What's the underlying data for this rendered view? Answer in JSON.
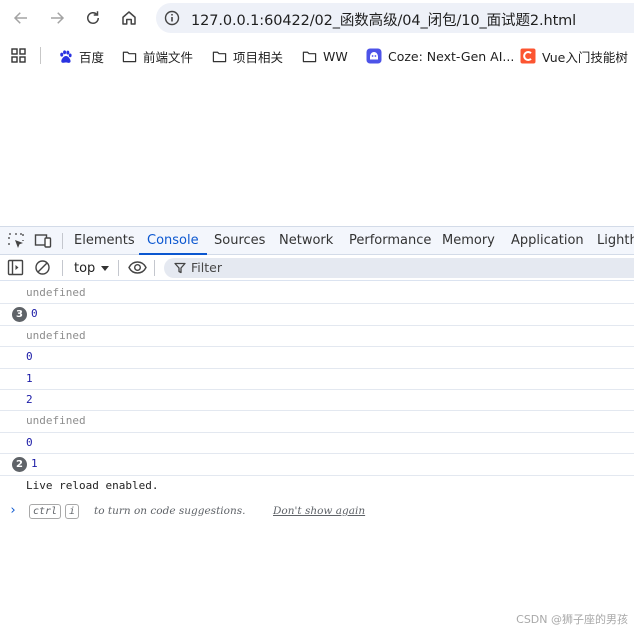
{
  "browser": {
    "url": "127.0.0.1:60422/02_函数高级/04_闭包/10_面试题2.html"
  },
  "bookmarks": [
    {
      "label": "百度",
      "icon": "baidu-paw-icon"
    },
    {
      "label": "前端文件",
      "icon": "folder-icon"
    },
    {
      "label": "项目相关",
      "icon": "folder-icon"
    },
    {
      "label": "WW",
      "icon": "folder-icon"
    },
    {
      "label": "Coze: Next-Gen AI...",
      "icon": "coze-icon"
    },
    {
      "label": "Vue入门技能树",
      "icon": "csdn-icon"
    }
  ],
  "devtools": {
    "tabs": [
      "Elements",
      "Console",
      "Sources",
      "Network",
      "Performance",
      "Memory",
      "Application",
      "Lighth"
    ],
    "active_tab": "Console"
  },
  "console_toolbar": {
    "context": "top",
    "filter_placeholder": "Filter"
  },
  "console": {
    "messages": [
      {
        "text": "undefined",
        "kind": "undef",
        "repeat": ""
      },
      {
        "text": "0",
        "kind": "num",
        "repeat": "3"
      },
      {
        "text": "undefined",
        "kind": "undef",
        "repeat": ""
      },
      {
        "text": "0",
        "kind": "num",
        "repeat": ""
      },
      {
        "text": "1",
        "kind": "num",
        "repeat": ""
      },
      {
        "text": "2",
        "kind": "num",
        "repeat": ""
      },
      {
        "text": "undefined",
        "kind": "undef",
        "repeat": ""
      },
      {
        "text": "0",
        "kind": "num",
        "repeat": ""
      },
      {
        "text": "1",
        "kind": "num",
        "repeat": "2"
      },
      {
        "text": "Live reload enabled.",
        "kind": "log",
        "repeat": ""
      }
    ],
    "prompt": {
      "key1": "ctrl",
      "key2": "i",
      "hint": "to turn on code suggestions.",
      "dismiss": "Don't show again"
    }
  },
  "watermark": "CSDN @狮子座的男孩",
  "colors": {
    "accent": "#0b57d0",
    "number": "#1a1aa6",
    "undefined": "#8e8e8e",
    "tab_strip_bg": "#f3f6fc"
  }
}
